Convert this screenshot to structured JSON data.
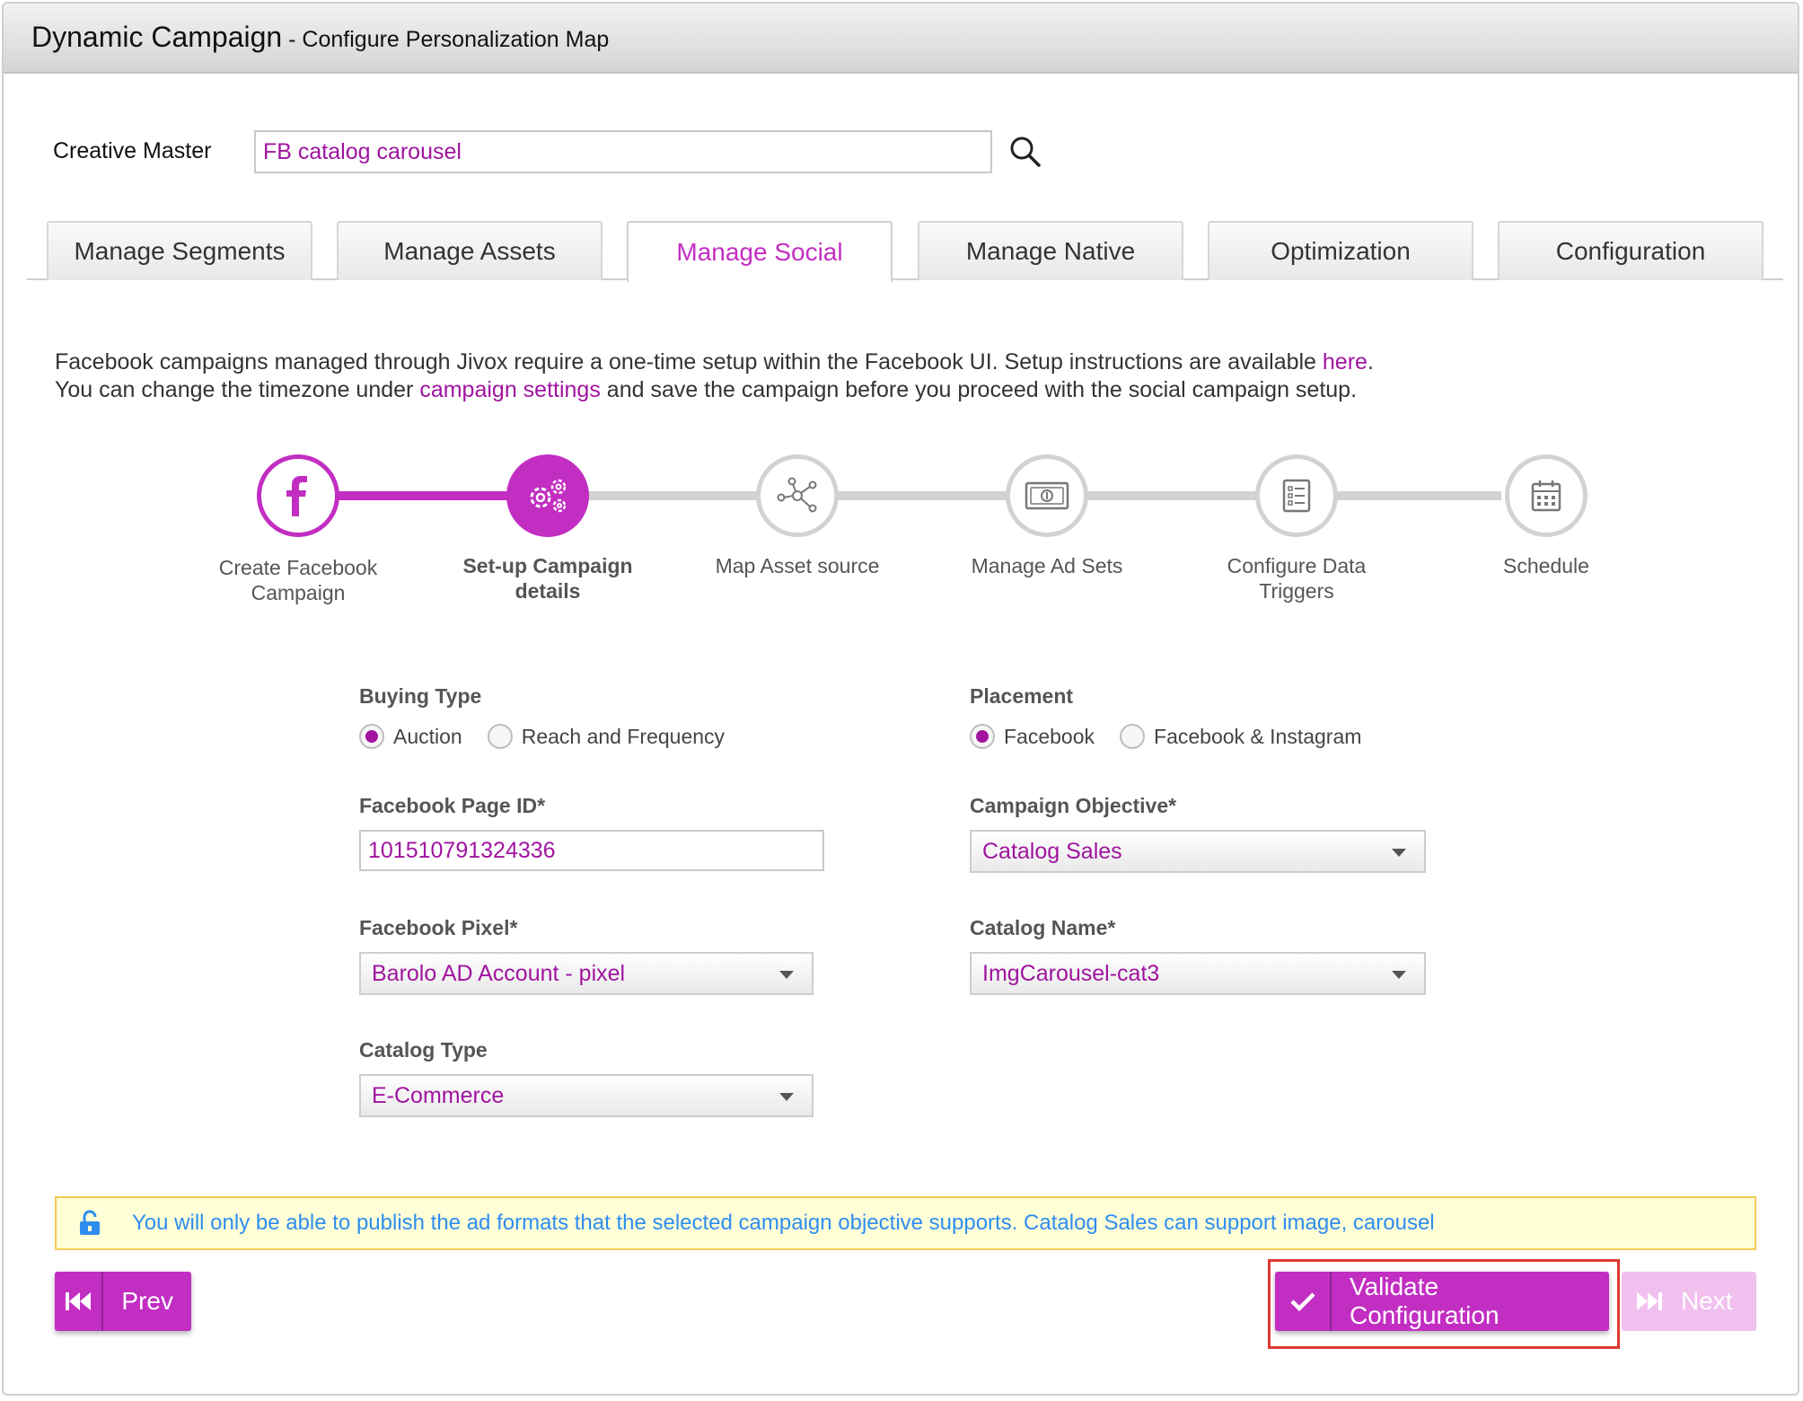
{
  "title": {
    "main": "Dynamic Campaign",
    "sub": " - Configure Personalization Map"
  },
  "creative_master": {
    "label": "Creative Master",
    "value": "FB catalog carousel"
  },
  "tabs": [
    {
      "label": "Manage Segments"
    },
    {
      "label": "Manage Assets"
    },
    {
      "label": "Manage Social"
    },
    {
      "label": "Manage Native"
    },
    {
      "label": "Optimization"
    },
    {
      "label": "Configuration"
    }
  ],
  "info": {
    "line1_pre": "Facebook campaigns managed through Jivox require a one-time setup within the Facebook UI. Setup instructions are available ",
    "line1_link": "here",
    "line1_post": ".",
    "line2_pre": "You can change the timezone under ",
    "line2_link": "campaign settings",
    "line2_post": " and save the campaign before you proceed with the social campaign setup."
  },
  "steps": [
    {
      "label": "Create Facebook Campaign",
      "icon": "facebook-icon",
      "state": "done"
    },
    {
      "label": "Set-up Campaign details",
      "icon": "gears-icon",
      "state": "current"
    },
    {
      "label": "Map Asset source",
      "icon": "network-icon",
      "state": "pending"
    },
    {
      "label": "Manage Ad Sets",
      "icon": "money-icon",
      "state": "pending"
    },
    {
      "label": "Configure Data Triggers",
      "icon": "checklist-icon",
      "state": "pending"
    },
    {
      "label": "Schedule",
      "icon": "calendar-icon",
      "state": "pending"
    }
  ],
  "form": {
    "buying_type": {
      "label": "Buying Type",
      "options": [
        "Auction",
        "Reach and Frequency"
      ],
      "selected": "Auction"
    },
    "placement": {
      "label": "Placement",
      "options": [
        "Facebook",
        "Facebook & Instagram"
      ],
      "selected": "Facebook"
    },
    "page_id": {
      "label": "Facebook Page ID*",
      "value": "101510791324336"
    },
    "objective": {
      "label": "Campaign Objective*",
      "value": "Catalog Sales"
    },
    "pixel": {
      "label": "Facebook Pixel*",
      "value": "Barolo AD Account - pixel"
    },
    "catalog_name": {
      "label": "Catalog Name*",
      "value": "ImgCarousel-cat3"
    },
    "catalog_type": {
      "label": "Catalog Type",
      "value": "E-Commerce"
    }
  },
  "notice": {
    "text": "You will only be able to publish the ad formats that the selected campaign objective supports. Catalog Sales can support image, carousel"
  },
  "buttons": {
    "prev": "Prev",
    "validate": "Validate Configuration",
    "next": "Next"
  },
  "colors": {
    "accent": "#c22ec2",
    "accent_text": "#a0149f",
    "notice_bg": "#ffffd7",
    "notice_text": "#2f8df0",
    "highlight": "#e0392f"
  }
}
